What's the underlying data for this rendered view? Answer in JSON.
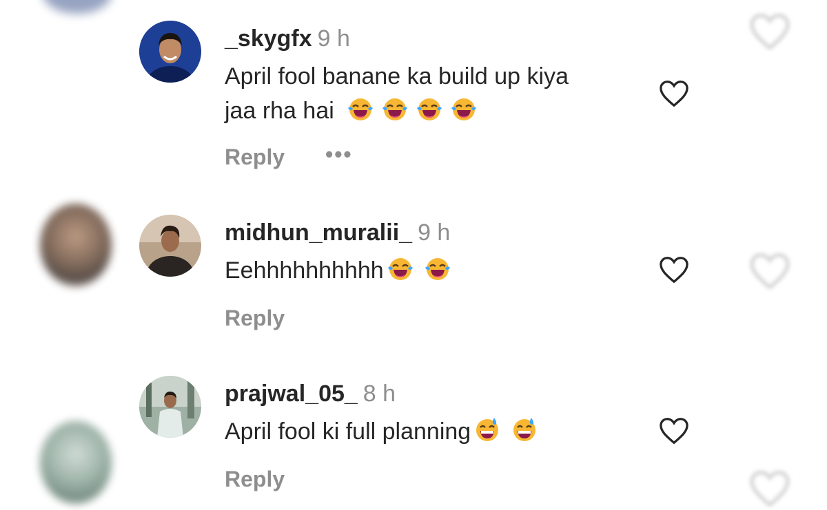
{
  "comments": [
    {
      "username": "_skygfx",
      "time": "9 h",
      "text_line1": "April fool banane ka build up kiya",
      "text_line2": "jaa rha hai",
      "emojis": [
        "face-with-tears-of-joy",
        "face-with-tears-of-joy",
        "face-with-tears-of-joy",
        "face-with-tears-of-joy"
      ],
      "reply_label": "Reply",
      "more_label": "•••"
    },
    {
      "username": "midhun_muralii_",
      "time": "9 h",
      "text": "Eehhhhhhhhhh",
      "emojis": [
        "face-with-tears-of-joy",
        "face-with-tears-of-joy"
      ],
      "reply_label": "Reply"
    },
    {
      "username": "prajwal_05_",
      "time": "8 h",
      "text": "April fool ki full planning",
      "emojis": [
        "grinning-face-with-sweat",
        "grinning-face-with-sweat"
      ],
      "reply_label": "Reply"
    }
  ],
  "colors": {
    "text": "#262626",
    "secondary": "#8e8e8e",
    "emoji_face": "#f7b733"
  },
  "icons": [
    "heart-outline-icon",
    "more-options-icon",
    "face-with-tears-of-joy",
    "grinning-face-with-sweat"
  ]
}
